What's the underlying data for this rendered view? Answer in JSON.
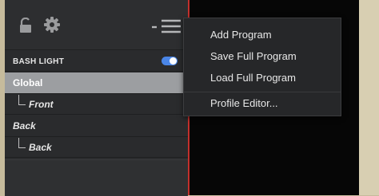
{
  "sidebar": {
    "header": {
      "label": "BASH LIGHT",
      "enabled": true
    },
    "tree": [
      {
        "label": "Global",
        "selected": true
      },
      {
        "label": "Front",
        "child": true
      },
      {
        "label": "Back"
      },
      {
        "label": "Back",
        "child": true
      }
    ]
  },
  "toolbar": {
    "lock_icon": "unlocked-lock-icon",
    "gear_icon": "gear-icon",
    "menu_icon": "hamburger-menu-icon"
  },
  "menu": {
    "items": [
      "Add Program",
      "Save Full Program",
      "Load Full Program",
      "Profile Editor..."
    ]
  },
  "colors": {
    "accent_red": "#c2302c",
    "toggle_blue": "#4a86e8",
    "selected_row": "#9c9ea1",
    "panel": "#2b2c2e"
  }
}
